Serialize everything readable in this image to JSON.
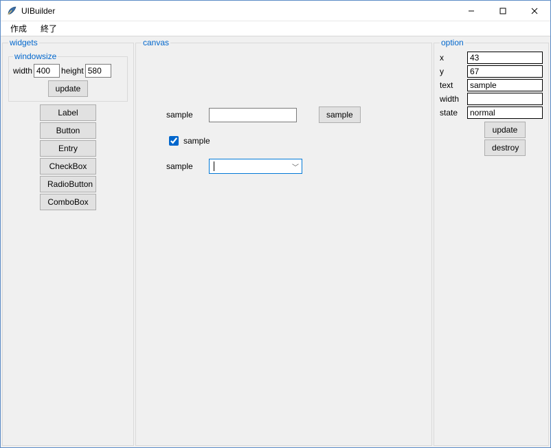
{
  "window": {
    "title": "UIBuilder"
  },
  "menu": {
    "create": "作成",
    "quit": "終了"
  },
  "panels": {
    "widgets_legend": "widgets",
    "canvas_legend": "canvas",
    "option_legend": "option",
    "windowsize_legend": "windowsize"
  },
  "windowsize": {
    "width_label": "width",
    "width_value": "400",
    "height_label": "height",
    "height_value": "580",
    "update_label": "update"
  },
  "widget_buttons": {
    "label": "Label",
    "button": "Button",
    "entry": "Entry",
    "checkbox": "CheckBox",
    "radiobutton": "RadioButton",
    "combobox": "ComboBox"
  },
  "canvas": {
    "sample_label1": "sample",
    "sample_button": "sample",
    "sample_checkbox_label": "sample",
    "sample_checkbox_checked": true,
    "sample_label2": "sample",
    "combo_value": ""
  },
  "option": {
    "x_label": "x",
    "x_value": "43",
    "y_label": "y",
    "y_value": "67",
    "text_label": "text",
    "text_value": "sample",
    "width_label": "width",
    "width_value": "",
    "state_label": "state",
    "state_value": "normal",
    "update_label": "update",
    "destroy_label": "destroy"
  }
}
